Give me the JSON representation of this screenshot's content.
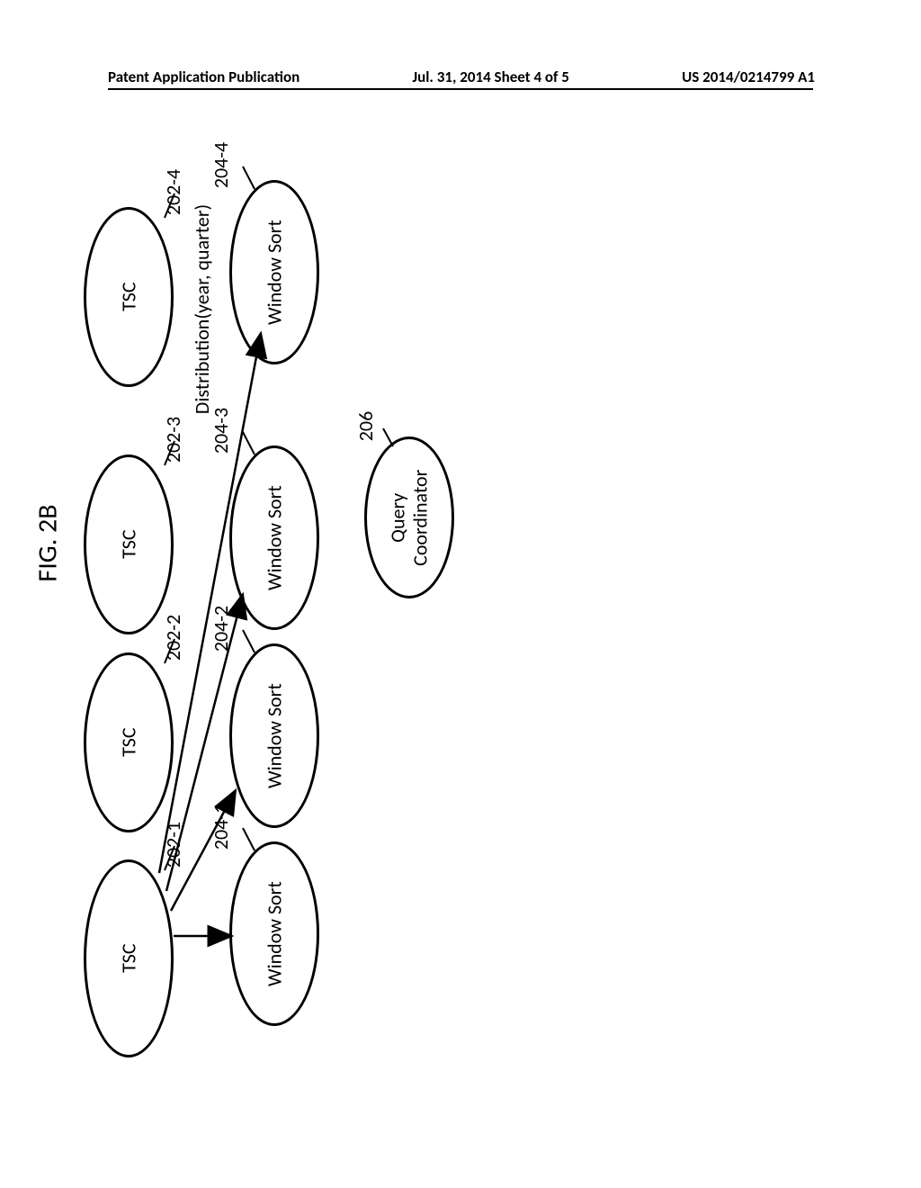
{
  "header": {
    "left": "Patent Application Publication",
    "center": "Jul. 31, 2014  Sheet 4 of 5",
    "right": "US 2014/0214799 A1"
  },
  "figure_label": "FIG. 2B",
  "nodes": {
    "query_coordinator": {
      "label": "Query\nCoordinator",
      "ref": "206"
    },
    "ws1": {
      "label": "Window Sort",
      "ref": "204-1"
    },
    "ws2": {
      "label": "Window Sort",
      "ref": "204-2"
    },
    "ws3": {
      "label": "Window Sort",
      "ref": "204-3"
    },
    "ws4": {
      "label": "Window Sort",
      "ref": "204-4"
    },
    "tsc1": {
      "label": "TSC",
      "ref": "202-1"
    },
    "tsc2": {
      "label": "TSC",
      "ref": "202-2"
    },
    "tsc3": {
      "label": "TSC",
      "ref": "202-3"
    },
    "tsc4": {
      "label": "TSC",
      "ref": "202-4"
    }
  },
  "annotation": "Distribution(year, quarter)"
}
